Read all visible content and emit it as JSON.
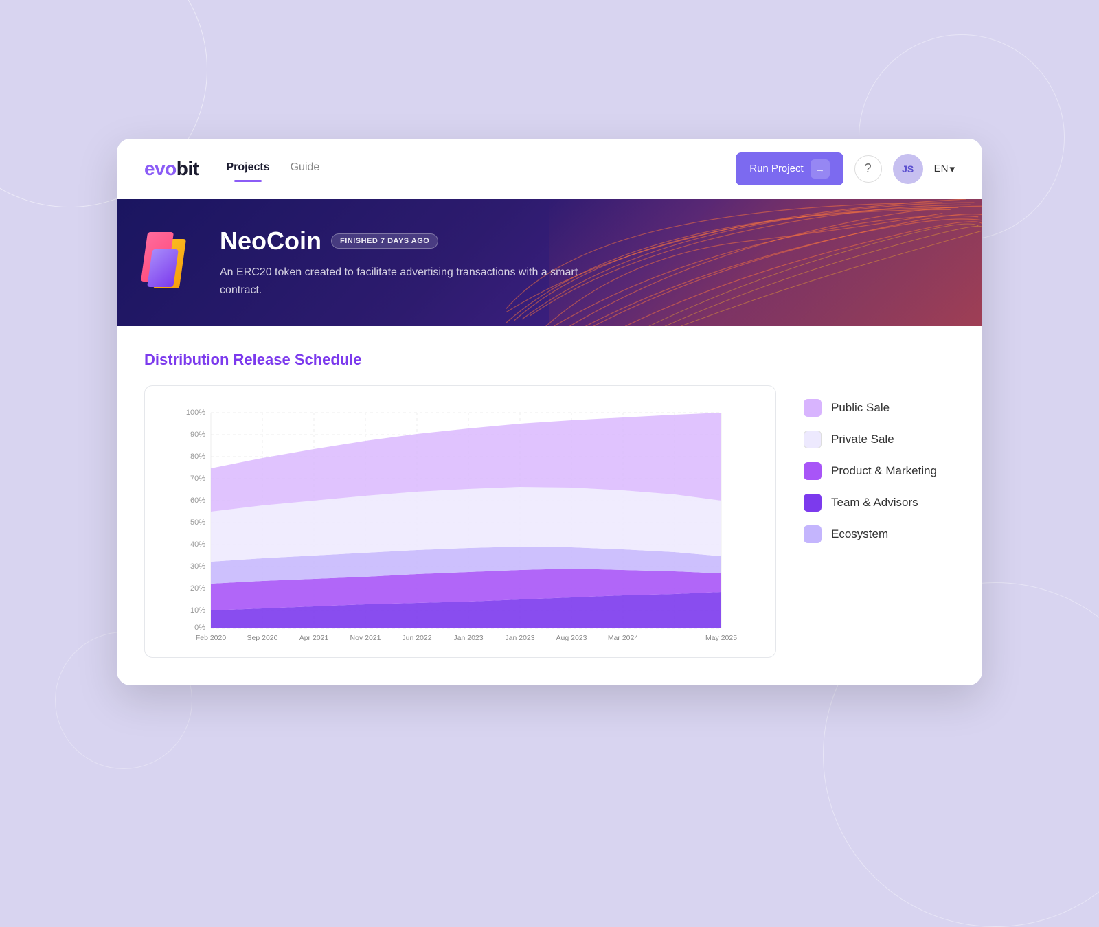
{
  "logo": {
    "evo": "evo",
    "bit": "bit"
  },
  "nav": {
    "items": [
      {
        "label": "Projects",
        "active": true
      },
      {
        "label": "Guide",
        "active": false
      }
    ]
  },
  "header": {
    "run_project_label": "Run Project",
    "lang_label": "EN",
    "avatar_initials": "JS"
  },
  "banner": {
    "title": "NeoCoin",
    "status": "FINISHED 7 Days ago",
    "description": "An ERC20 token created to facilitate advertising transactions with a smart contract."
  },
  "chart": {
    "title": "Distribution Release Schedule",
    "y_labels": [
      "100%",
      "90%",
      "80%",
      "70%",
      "60%",
      "50%",
      "40%",
      "30%",
      "20%",
      "10%",
      "0%"
    ],
    "x_labels": [
      "Feb 2020",
      "Sep 2020",
      "Apr 2021",
      "Nov 2021",
      "Jun 2022",
      "Jan 2023",
      "Jan 2023",
      "Aug 2023",
      "Mar 2024",
      "May 2025"
    ]
  },
  "legend": {
    "items": [
      {
        "label": "Public Sale",
        "color": "#d8b4fe"
      },
      {
        "label": "Private Sale",
        "color": "#ede9fe"
      },
      {
        "label": "Product & Marketing",
        "color": "#a855f7"
      },
      {
        "label": "Team & Advisors",
        "color": "#7c3aed"
      },
      {
        "label": "Ecosystem",
        "color": "#c4b5fd"
      }
    ]
  }
}
